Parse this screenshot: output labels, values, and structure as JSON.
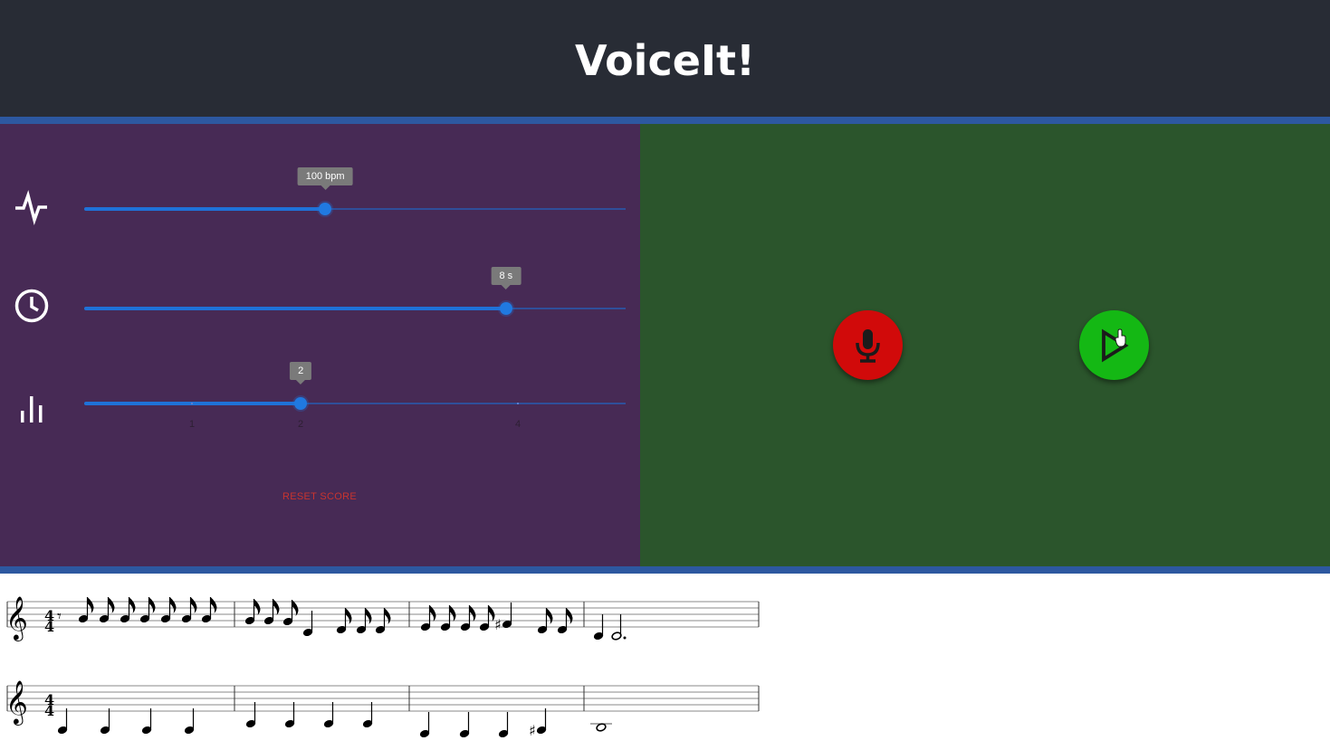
{
  "app": {
    "title": "VoiceIt!"
  },
  "controls": {
    "tempo": {
      "icon": "activity-pulse-icon",
      "value_label": "100 bpm",
      "fraction": 0.445
    },
    "duration": {
      "icon": "clock-icon",
      "value_label": "8 s",
      "fraction": 0.779
    },
    "measures": {
      "icon": "bar-chart-icon",
      "value_label": "2",
      "fraction": 0.4,
      "marks": [
        "1",
        "2",
        "4"
      ]
    },
    "reset_label": "RESET SCORE"
  },
  "actions": {
    "record": {
      "icon": "microphone-icon",
      "color": "#d10a0a"
    },
    "play": {
      "icon": "play-icon",
      "color": "#14b814"
    }
  },
  "score": {
    "time_signature": [
      "4",
      "4"
    ],
    "clef": "treble-clef-icon"
  }
}
